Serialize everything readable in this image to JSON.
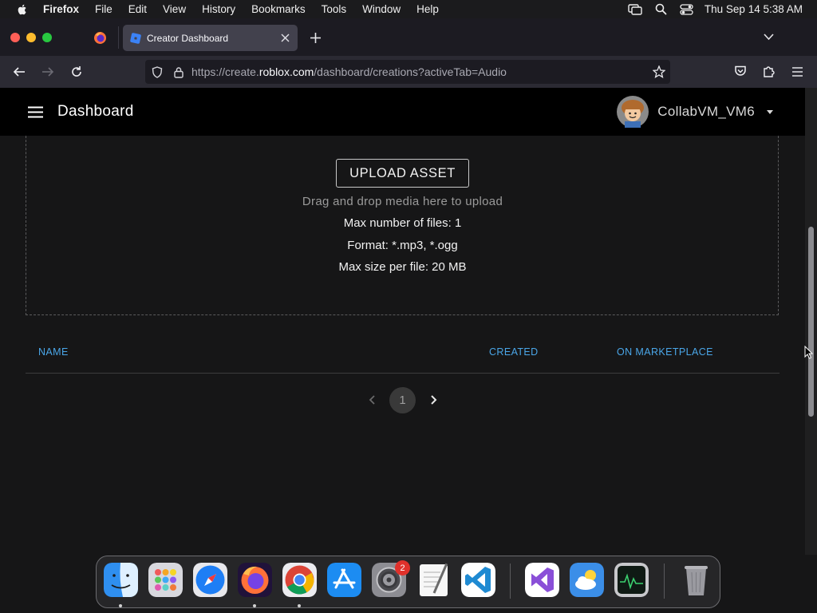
{
  "menubar": {
    "app_name": "Firefox",
    "menus": [
      "File",
      "Edit",
      "View",
      "History",
      "Bookmarks",
      "Tools",
      "Window",
      "Help"
    ],
    "clock": "Thu Sep 14  5:38 AM"
  },
  "browser": {
    "tab_title": "Creator Dashboard",
    "url_prefix": "https://create.",
    "url_host": "roblox.com",
    "url_path": "/dashboard/creations?activeTab=Audio"
  },
  "header": {
    "title": "Dashboard",
    "username": "CollabVM_VM6"
  },
  "upload": {
    "button_label": "UPLOAD ASSET",
    "drag_hint": "Drag and drop media here to upload",
    "max_files": "Max number of files: 1",
    "format": "Format: *.mp3, *.ogg",
    "max_size": "Max size per file: 20 MB"
  },
  "table": {
    "columns": [
      "NAME",
      "CREATED",
      "ON MARKETPLACE"
    ]
  },
  "pagination": {
    "current_page": "1"
  },
  "dock": {
    "apps": [
      "finder-icon",
      "launchpad-icon",
      "safari-icon",
      "firefox-icon",
      "chrome-icon",
      "app-store-icon",
      "system-settings-icon",
      "textedit-icon",
      "vscode-icon",
      "visual-studio-icon",
      "weather-icon",
      "activity-monitor-icon",
      "trash-icon"
    ],
    "settings_badge": "2"
  },
  "colors": {
    "link_blue": "#4aa6e8",
    "header_bg": "#000000",
    "page_bg": "#161617"
  }
}
